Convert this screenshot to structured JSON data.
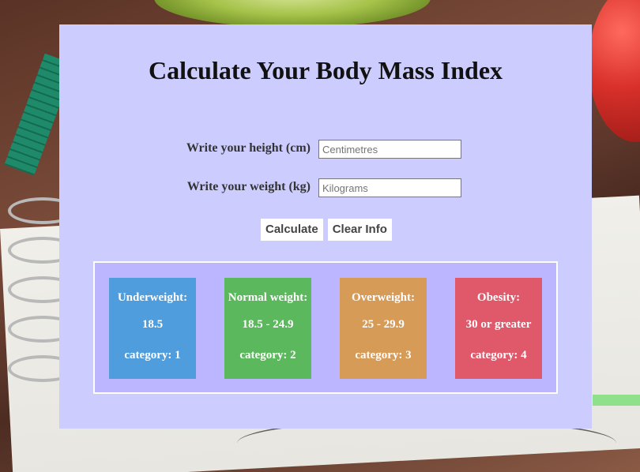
{
  "page": {
    "title": "Calculate Your Body Mass Index"
  },
  "form": {
    "height_label": "Write your height (cm)",
    "height_placeholder": "Centimetres",
    "height_value": "",
    "weight_label": "Write your weight (kg)",
    "weight_placeholder": "Kilograms",
    "weight_value": ""
  },
  "buttons": {
    "calculate": "Calculate",
    "clear": "Clear Info"
  },
  "categories": [
    {
      "name": "Underweight:",
      "range": "18.5",
      "category": "category: 1",
      "color": "#4f9ddd"
    },
    {
      "name": "Normal weight:",
      "range": "18.5 - 24.9",
      "category": "category: 2",
      "color": "#5cb85c"
    },
    {
      "name": "Overweight:",
      "range": "25 - 29.9",
      "category": "category: 3",
      "color": "#d79b58"
    },
    {
      "name": "Obesity:",
      "range": "30 or greater",
      "category": "category: 4",
      "color": "#e0596b"
    }
  ],
  "colors": {
    "panel": "#ccccff",
    "legend_bg": "#bbb6ff"
  }
}
